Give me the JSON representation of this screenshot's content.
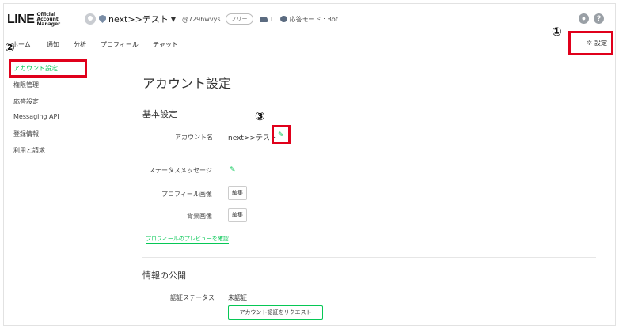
{
  "header": {
    "logo_line": "LINE",
    "logo_sub": "Official Account Manager",
    "account_name": "next>>テスト",
    "account_id": "@729hwvys",
    "plan_badge": "フリー",
    "friends_count": "1",
    "response_mode": "応答モード : Bot"
  },
  "nav": {
    "items": [
      "ホーム",
      "通知",
      "分析",
      "プロフィール",
      "チャット"
    ],
    "settings_label": "設定"
  },
  "sidebar": {
    "items": [
      "アカウント設定",
      "権限管理",
      "応答設定",
      "Messaging API",
      "登録情報",
      "利用と請求"
    ]
  },
  "main": {
    "page_title": "アカウント設定",
    "basic_section_title": "基本設定",
    "account_name_label": "アカウント名",
    "account_name_value": "next>>テスト",
    "status_message_label": "ステータスメッセージ",
    "profile_image_label": "プロフィール画像",
    "background_image_label": "背景画像",
    "edit_button_label": "編集",
    "preview_link": "プロフィールのプレビューを確認",
    "public_section_title": "情報の公開",
    "verification_label": "認証ステータス",
    "verification_value": "未認証",
    "request_button": "アカウント認証をリクエスト"
  },
  "annotations": {
    "markers": [
      "①",
      "②",
      "③"
    ],
    "box_color": "#e0001b"
  },
  "colors": {
    "accent": "#06c755"
  }
}
